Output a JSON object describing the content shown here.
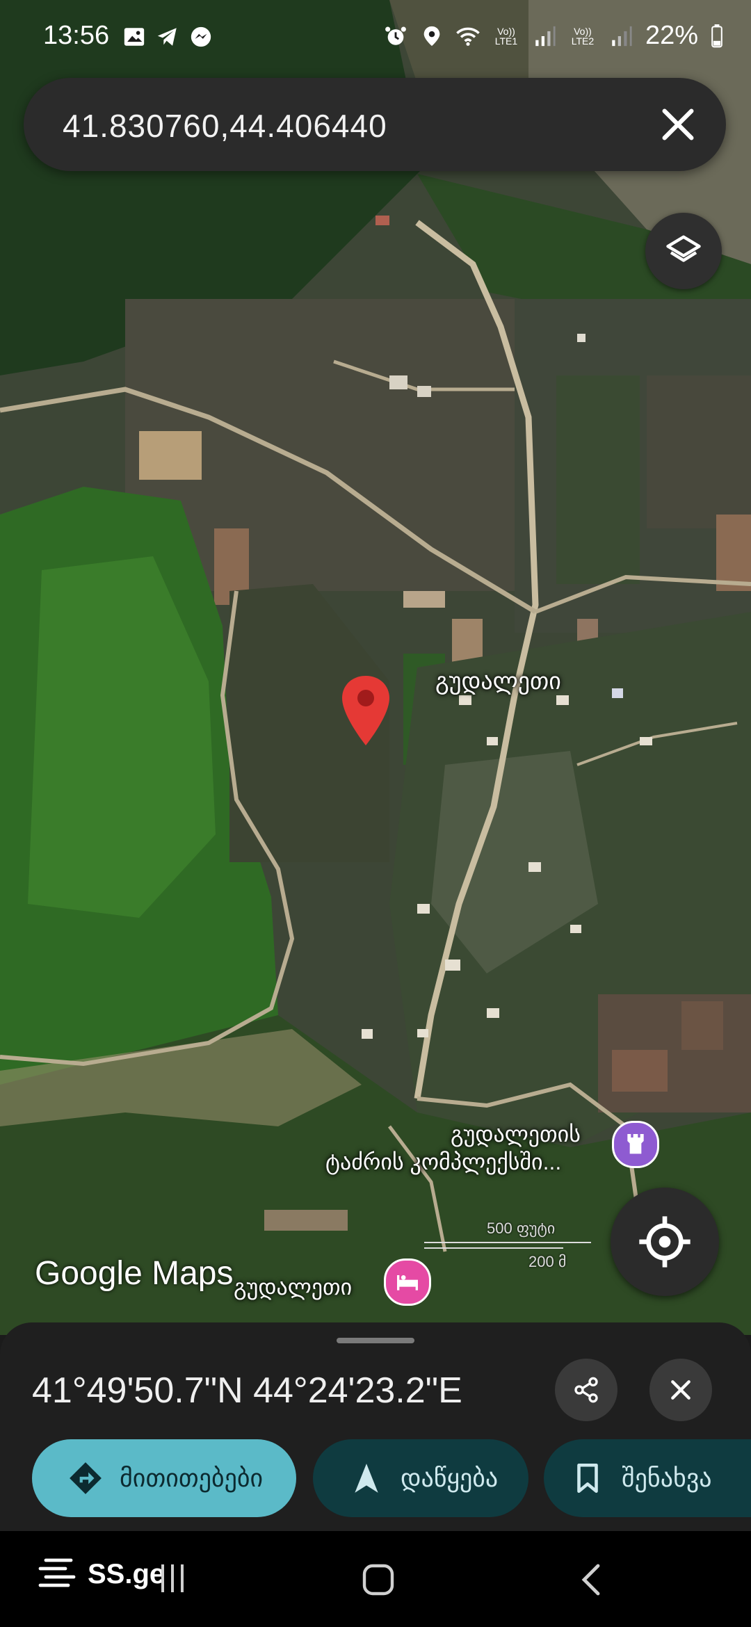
{
  "status_bar": {
    "time": "13:56",
    "left_icons": [
      "gallery-icon",
      "telegram-icon",
      "messenger-icon"
    ],
    "right_icons": [
      "alarm-icon",
      "location-icon",
      "wifi-icon",
      "signal-lte1-icon",
      "signal-lte2-icon",
      "battery-icon"
    ],
    "sim1_label": "Vo)) LTE1",
    "sim2_label": "Vo)) LTE2",
    "battery": "22%"
  },
  "search": {
    "query": "41.830760,44.406440",
    "clear_icon": "close-icon"
  },
  "map": {
    "place_labels": {
      "village": "გუდალეთი",
      "church_line1": "გუდალეთის",
      "church_line2": "ტაძრის კომპლექსში...",
      "hotel": "გუდალეთი"
    },
    "scale": {
      "top": "500 ფუტი",
      "bottom": "200 მ"
    },
    "attribution": "Google Maps",
    "colors": {
      "pin": "#e53935",
      "church_poi": "#8e5bd1",
      "hotel_poi": "#e54aa4"
    }
  },
  "bottom_sheet": {
    "coords": "41°49'50.7\"N 44°24'23.2\"E",
    "actions": {
      "directions": "მითითებები",
      "start": "დაწყება",
      "save": "შენახვა"
    },
    "colors": {
      "primary": "#5bbac8",
      "secondary": "#0f3b40"
    }
  },
  "navbar": {
    "app_label": "SS.ge"
  }
}
